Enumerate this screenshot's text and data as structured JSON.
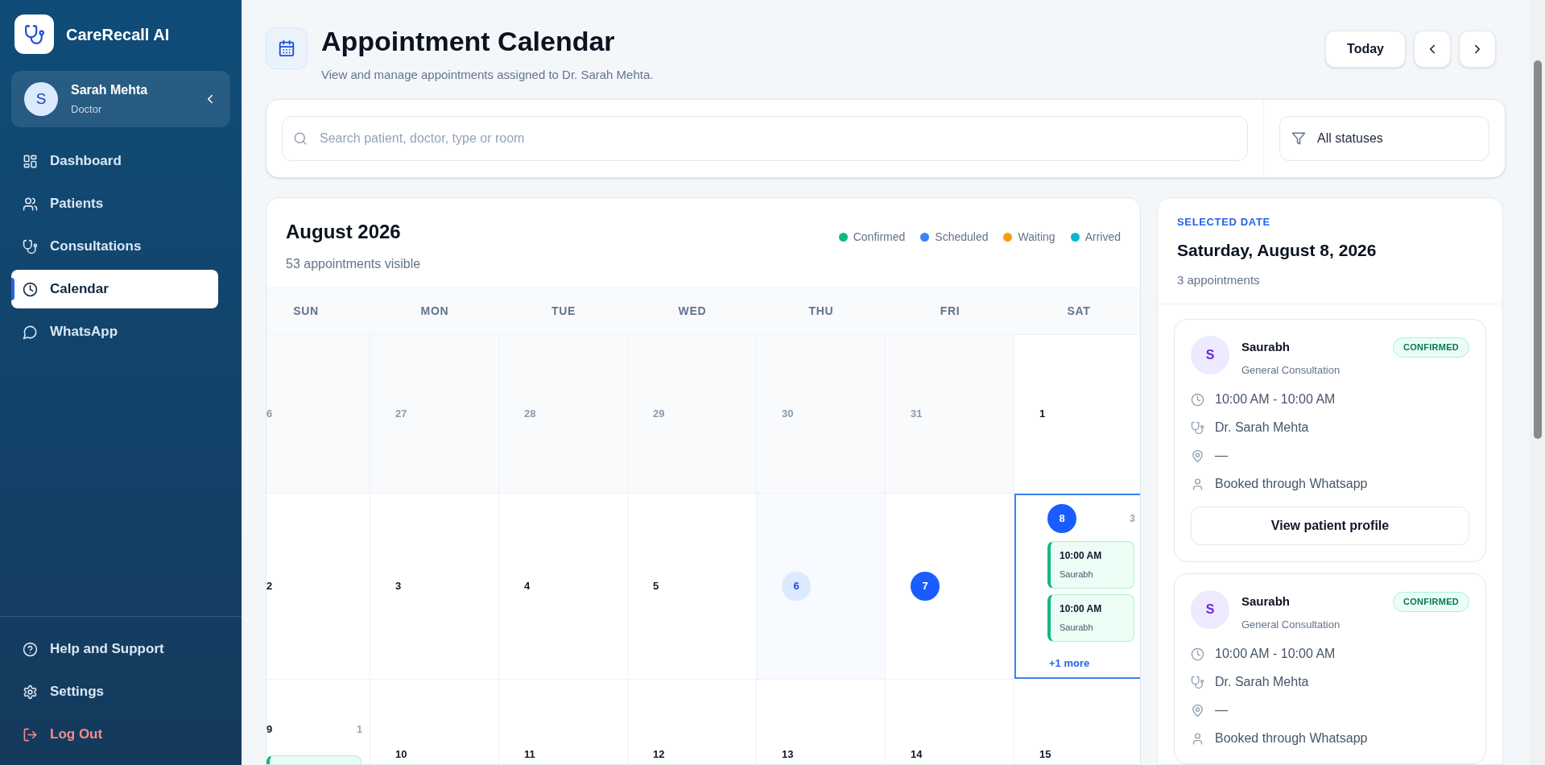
{
  "sidebar": {
    "brand": "CareRecall AI",
    "user": {
      "initial": "S",
      "name": "Sarah Mehta",
      "role": "Doctor"
    },
    "nav": [
      {
        "label": "Dashboard",
        "selected": false
      },
      {
        "label": "Patients",
        "selected": false
      },
      {
        "label": "Consultations",
        "selected": false
      },
      {
        "label": "Calendar",
        "selected": true
      },
      {
        "label": "WhatsApp",
        "selected": false
      }
    ],
    "footer": [
      {
        "label": "Help and Support",
        "kind": "normal"
      },
      {
        "label": "Settings",
        "kind": "normal"
      },
      {
        "label": "Log Out",
        "kind": "danger"
      }
    ]
  },
  "header": {
    "title": "Appointment Calendar",
    "subtitle": "View and manage appointments assigned to Dr. Sarah Mehta.",
    "today_button": "Today"
  },
  "filters": {
    "search_placeholder": "Search patient, doctor, type or room",
    "status_value": "All statuses"
  },
  "calendar": {
    "title": "August 2026",
    "subtitle": "53 appointments visible",
    "legend": [
      {
        "label": "Confirmed",
        "color": "#10b981"
      },
      {
        "label": "Scheduled",
        "color": "#3b82f6"
      },
      {
        "label": "Waiting",
        "color": "#f59e0b"
      },
      {
        "label": "Arrived",
        "color": "#06b6d4"
      }
    ],
    "weekdays": [
      "SUN",
      "MON",
      "TUE",
      "WED",
      "THU",
      "FRI",
      "SAT"
    ],
    "weeks": [
      [
        {
          "day": "6",
          "outside": true,
          "kind": "plain",
          "selected": false
        },
        {
          "day": "27",
          "outside": true,
          "kind": "plain",
          "selected": false
        },
        {
          "day": "28",
          "outside": true,
          "kind": "plain",
          "selected": false
        },
        {
          "day": "29",
          "outside": true,
          "kind": "plain",
          "selected": false
        },
        {
          "day": "30",
          "outside": true,
          "kind": "plain",
          "selected": false
        },
        {
          "day": "31",
          "outside": true,
          "kind": "plain",
          "selected": false
        },
        {
          "day": "1",
          "outside": false,
          "kind": "plain",
          "selected": false
        }
      ],
      [
        {
          "day": "2",
          "outside": false,
          "kind": "plain",
          "selected": false
        },
        {
          "day": "3",
          "outside": false,
          "kind": "plain",
          "selected": false
        },
        {
          "day": "4",
          "outside": false,
          "kind": "plain",
          "selected": false
        },
        {
          "day": "5",
          "outside": false,
          "kind": "plain",
          "selected": false
        },
        {
          "day": "6",
          "outside": false,
          "kind": "today",
          "selected": false
        },
        {
          "day": "7",
          "outside": false,
          "kind": "filled",
          "selected": false
        },
        {
          "day": "8",
          "outside": false,
          "kind": "filled",
          "selected": true,
          "count": "3",
          "appointments": [
            {
              "time": "10:00 AM",
              "name": "Saurabh",
              "kind": "confirmed"
            },
            {
              "time": "10:00 AM",
              "name": "Saurabh",
              "kind": "confirmed"
            }
          ],
          "more": "+1 more"
        }
      ],
      [
        {
          "day": "9",
          "outside": false,
          "kind": "plain",
          "selected": false,
          "count": "1"
        },
        {
          "day": "10",
          "outside": false,
          "kind": "plain",
          "selected": false
        },
        {
          "day": "11",
          "outside": false,
          "kind": "plain",
          "selected": false
        },
        {
          "day": "12",
          "outside": false,
          "kind": "plain",
          "selected": false
        },
        {
          "day": "13",
          "outside": false,
          "kind": "plain",
          "selected": false
        },
        {
          "day": "14",
          "outside": false,
          "kind": "plain",
          "selected": false
        },
        {
          "day": "15",
          "outside": false,
          "kind": "plain",
          "selected": false
        }
      ]
    ]
  },
  "selected_day": {
    "eyebrow": "SELECTED DATE",
    "date": "Saturday, August 8, 2026",
    "count_text": "3 appointments",
    "appointments": [
      {
        "initial": "S",
        "name": "Saurabh",
        "type": "General Consultation",
        "status": "CONFIRMED",
        "kind": "confirmed",
        "time": "10:00 AM - 10:00 AM",
        "doctor": "Dr. Sarah Mehta",
        "location": "—",
        "source": "Booked through Whatsapp",
        "button": "View patient profile"
      },
      {
        "initial": "S",
        "name": "Saurabh",
        "type": "General Consultation",
        "status": "CONFIRMED",
        "kind": "confirmed",
        "time": "10:00 AM - 10:00 AM",
        "doctor": "Dr. Sarah Mehta",
        "location": "—",
        "source": "Booked through Whatsapp"
      }
    ]
  }
}
